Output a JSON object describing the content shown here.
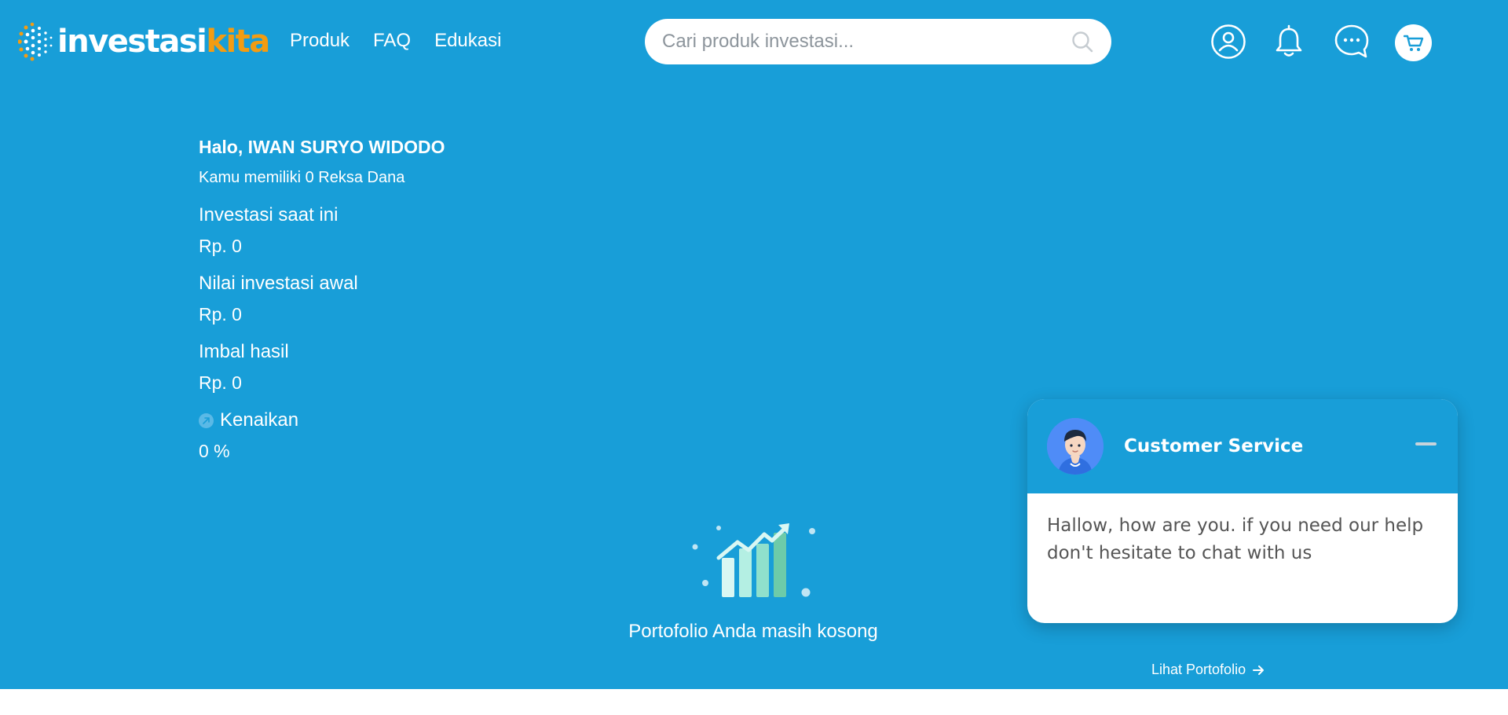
{
  "brand": {
    "logo_main": "investasi",
    "logo_accent": "kita",
    "accent_color": "#f39c12",
    "bg_color": "#189ed8"
  },
  "nav": [
    {
      "label": "Produk"
    },
    {
      "label": "FAQ"
    },
    {
      "label": "Edukasi"
    }
  ],
  "search": {
    "placeholder": "Cari produk investasi..."
  },
  "header_icons": [
    "user-circle-icon",
    "bell-icon",
    "chat-bubble-icon",
    "cart-icon"
  ],
  "summary": {
    "greeting": "Halo, IWAN SURYO WIDODO",
    "subtitle": "Kamu memiliki 0 Reksa Dana",
    "current_label": "Investasi saat ini",
    "current_value": "Rp.  0",
    "initial_label": "Nilai investasi awal",
    "initial_value": "Rp.  0",
    "return_label": "Imbal hasil",
    "return_value": "Rp.  0",
    "rise_label": "Kenaikan",
    "rise_value": "0 %"
  },
  "portfolio": {
    "empty_text": "Portofolio Anda masih kosong",
    "see_link": "Lihat Portofolio"
  },
  "chat": {
    "title": "Customer Service",
    "message": "Hallow, how are you. if you need our help don't hesitate to chat with us"
  }
}
